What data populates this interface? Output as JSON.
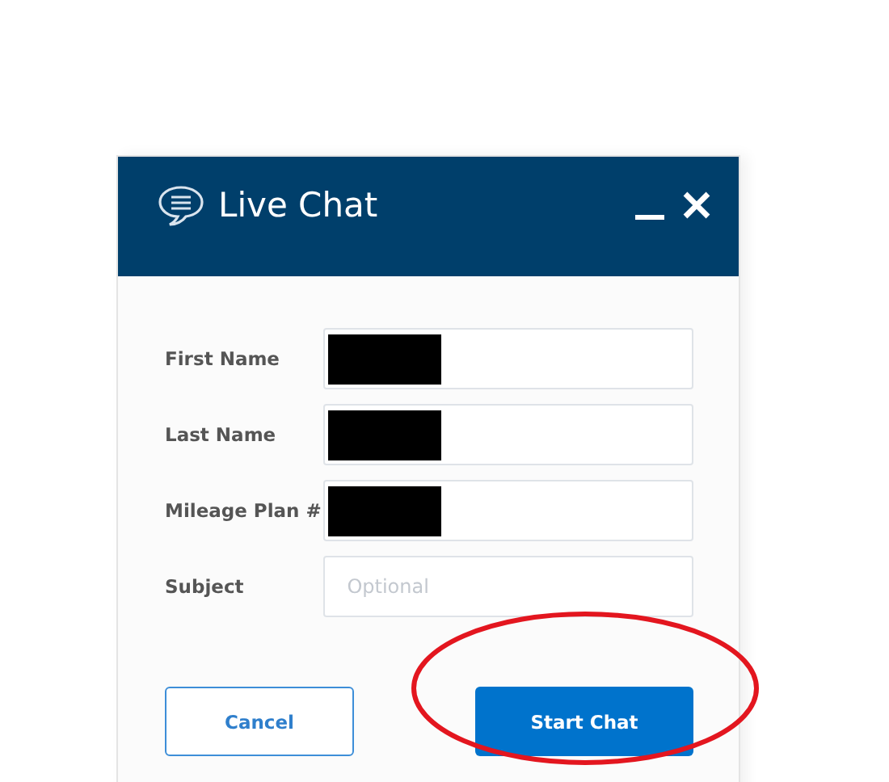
{
  "window": {
    "title": "Live Chat"
  },
  "fields": [
    {
      "label": "First Name",
      "redacted": true
    },
    {
      "label": "Last Name",
      "redacted": true
    },
    {
      "label": "Mileage Plan #",
      "redacted": true
    },
    {
      "label": "Subject",
      "placeholder": "Optional",
      "redacted": false
    }
  ],
  "buttons": [
    {
      "label": "Cancel",
      "kind": "secondary"
    },
    {
      "label": "Start Chat",
      "kind": "primary"
    }
  ],
  "annotation": {
    "kind": "ellipse",
    "color": "#e3161f"
  }
}
